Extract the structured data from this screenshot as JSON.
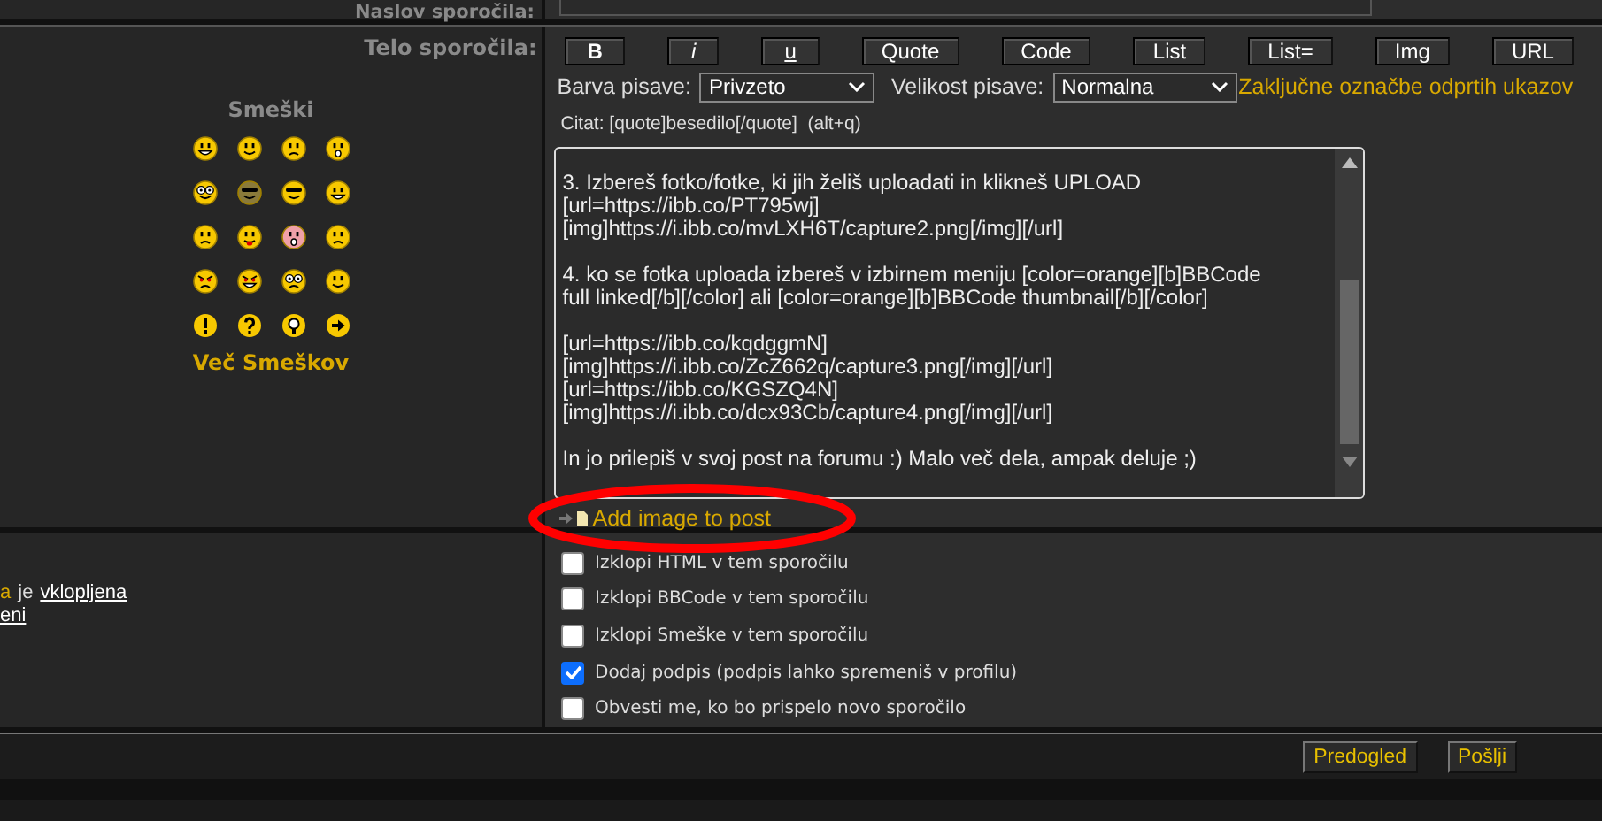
{
  "subject_row": {
    "label": "Naslov sporočila:"
  },
  "body_row": {
    "label": "Telo sporočila:"
  },
  "smilies": {
    "title": "Smeški",
    "more_link": "Več Smeškov"
  },
  "toolbar": {
    "buttons": [
      "B",
      "i",
      "u",
      "Quote",
      "Code",
      "List",
      "List=",
      "Img",
      "URL"
    ]
  },
  "font_color": {
    "label": "Barva pisave:",
    "value": "Privzeto"
  },
  "font_size": {
    "label": "Velikost pisave:",
    "value": "Normalna"
  },
  "close_tags_link": "Zaključne označbe odprtih ukazov",
  "help_line": "Citat: [quote]besedilo[/quote]  (alt+q)",
  "message_paragraphs": [
    [
      "3. Izbereš fotko/fotke, ki jih želiš uploadati in klikneš UPLOAD",
      "[url=https://ibb.co/PT795wj]",
      "[img]https://i.ibb.co/mvLXH6T/capture2.png[/img][/url]"
    ],
    [
      "4. ko se fotka uploada izbereš v izbirnem meniju [color=orange][b]BBCode",
      "full linked[/b][/color] ali [color=orange][b]BBCode thumbnail[/b][/color]"
    ],
    [
      "[url=https://ibb.co/kqdggmN]",
      "[img]https://i.ibb.co/ZcZ662q/capture3.png[/img][/url]",
      "[url=https://ibb.co/KGSZQ4N]",
      "[img]https://i.ibb.co/dcx93Cb/capture4.png[/img][/url]"
    ],
    [
      "In jo prilepiš v svoj post na forumu :) Malo več dela, ampak deluje ;)"
    ]
  ],
  "add_image_link": "Add image to post",
  "left_notes": [
    {
      "parts": [
        {
          "text": "a",
          "kind": "highlight"
        },
        {
          "text": "je",
          "kind": "plain"
        },
        {
          "text": "vklopljena",
          "kind": "link"
        }
      ]
    },
    {
      "parts": [
        {
          "text": "eni",
          "kind": "link"
        }
      ]
    }
  ],
  "options": [
    {
      "label": "Izklopi HTML v tem sporočilu",
      "checked": false
    },
    {
      "label": "Izklopi BBCode v tem sporočilu",
      "checked": false
    },
    {
      "label": "Izklopi Smeške v tem sporočilu",
      "checked": false
    },
    {
      "label": "Dodaj podpis (podpis lahko spremeniš v profilu)",
      "checked": true
    },
    {
      "label": "Obvesti me, ko bo prispelo novo sporočilo",
      "checked": false
    }
  ],
  "actions": [
    "Predogled",
    "Pošlji"
  ]
}
